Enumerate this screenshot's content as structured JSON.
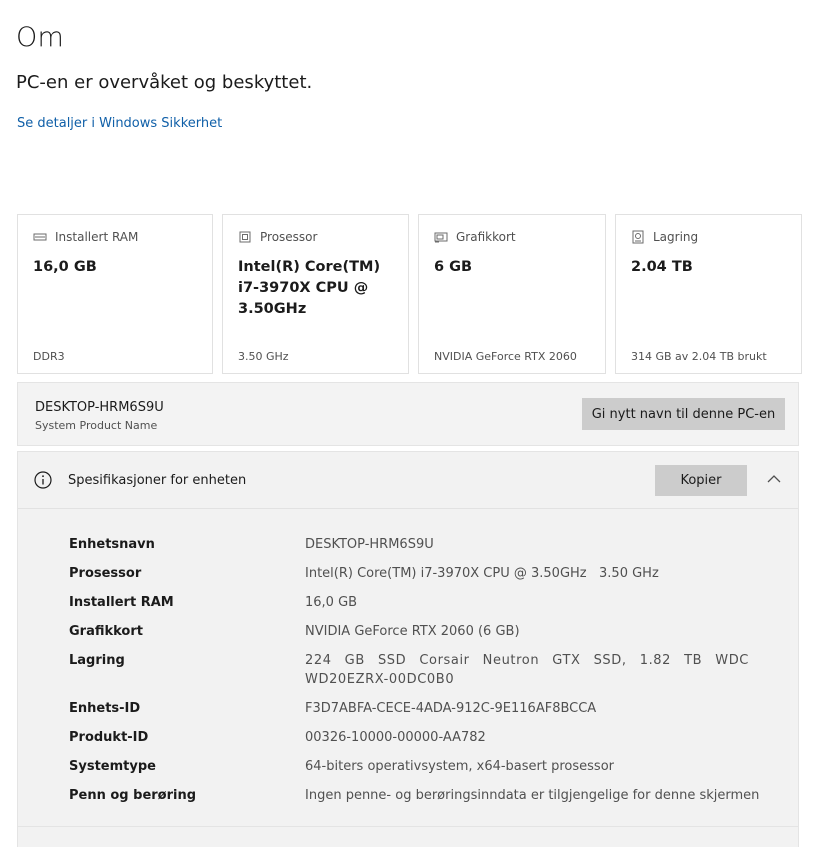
{
  "header": {
    "title": "Om",
    "status": "PC-en er overvåket og beskyttet.",
    "security_link": "Se detaljer i Windows Sikkerhet"
  },
  "cards": [
    {
      "label": "Installert RAM",
      "value": "16,0 GB",
      "sub": "DDR3",
      "icon": "ram-icon"
    },
    {
      "label": "Prosessor",
      "value": "Intel(R) Core(TM) i7-3970X CPU @ 3.50GHz",
      "sub": "3.50 GHz",
      "icon": "processor-icon"
    },
    {
      "label": "Grafikkort",
      "value": "6 GB",
      "sub": "NVIDIA GeForce RTX 2060",
      "icon": "graphics-card-icon"
    },
    {
      "label": "Lagring",
      "value": "2.04 TB",
      "sub": "314 GB av 2.04 TB brukt",
      "icon": "storage-icon"
    }
  ],
  "device": {
    "name": "DESKTOP-HRM6S9U",
    "sub": "System Product Name",
    "rename_label": "Gi nytt navn til denne PC-en"
  },
  "specs": {
    "title": "Spesifikasjoner for enheten",
    "copy_label": "Kopier",
    "rows": [
      {
        "label": "Enhetsnavn",
        "value": "DESKTOP-HRM6S9U"
      },
      {
        "label": "Prosessor",
        "value": "Intel(R) Core(TM) i7-3970X CPU @ 3.50GHz   3.50 GHz"
      },
      {
        "label": "Installert RAM",
        "value": "16,0 GB"
      },
      {
        "label": "Grafikkort",
        "value": "NVIDIA GeForce RTX 2060 (6 GB)"
      },
      {
        "label": "Lagring",
        "value": "224 GB SSD Corsair Neutron GTX SSD, 1.82 TB WDC WD20EZRX-00DC0B0"
      },
      {
        "label": "Enhets-ID",
        "value": "F3D7ABFA-CECE-4ADA-912C-9E116AF8BCCA"
      },
      {
        "label": "Produkt-ID",
        "value": "00326-10000-00000-AA782"
      },
      {
        "label": "Systemtype",
        "value": "64-biters operativsystem, x64-basert prosessor"
      },
      {
        "label": "Penn og berøring",
        "value": "Ingen penne- og berøringsinndata er tilgjengelige for denne skjermen"
      }
    ]
  },
  "colors": {
    "link": "#0f5fa8",
    "button_bg": "#cccccc",
    "panel_bg": "#f2f2f2",
    "text_primary": "#1b1b1b",
    "text_secondary": "#505050"
  }
}
